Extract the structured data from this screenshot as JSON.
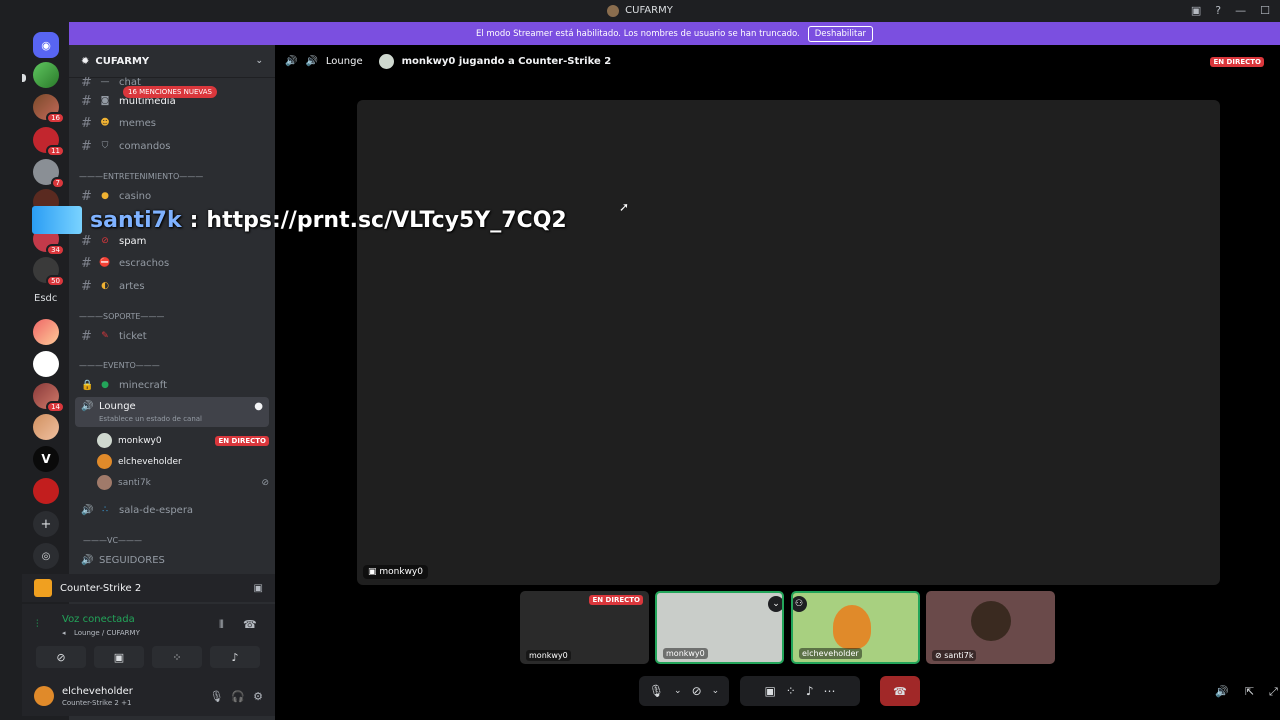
{
  "window": {
    "title": "CUFARMY"
  },
  "banner": {
    "text": "El modo Streamer está habilitado. Los nombres de usuario se han truncado.",
    "button": "Deshabilitar"
  },
  "guilds": {
    "badges": [
      "16",
      "11",
      "7",
      "34",
      "50",
      "14"
    ],
    "text_server": "Esdc"
  },
  "server": {
    "name": "CUFARMY"
  },
  "channels": {
    "chat": "chat",
    "multimedia": "multimedia",
    "mentions_pill": "16 MENCIONES NUEVAS",
    "memes": "memes",
    "comandos": "comandos",
    "cat_entretenimiento": "———ENTRETENIMIENTO———",
    "casino": "casino",
    "spam": "spam",
    "escrachos": "escrachos",
    "artes": "artes",
    "cat_soporte": "———SOPORTE———",
    "ticket": "ticket",
    "cat_evento": "———EVENTO———",
    "minecraft": "minecraft",
    "lounge": "Lounge",
    "lounge_status": "Establece un estado de canal",
    "sala_espera": "sala-de-espera",
    "cat_vc": "———VC———",
    "seguidores": "SEGUIDORES"
  },
  "voice_users": [
    {
      "name": "monkwy0",
      "live": "EN DIRECTO"
    },
    {
      "name": "elcheveholder"
    },
    {
      "name": "santi7k"
    }
  ],
  "activity": {
    "game": "Counter-Strike 2"
  },
  "voice_panel": {
    "status": "Voz conectada",
    "location": "Lounge / CUFARMY"
  },
  "user_panel": {
    "name": "elcheveholder",
    "status": "Counter-Strike 2 +1"
  },
  "main_header": {
    "channel": "Lounge",
    "activity": "monkwy0 jugando a Counter-Strike 2",
    "live": "EN DIRECTO"
  },
  "stream": {
    "owner": "monkwy0"
  },
  "tiles": [
    {
      "name": "monkwy0",
      "live": "EN DIRECTO"
    },
    {
      "name": "monkwy0"
    },
    {
      "name": "elcheveholder"
    },
    {
      "name": "santi7k"
    }
  ],
  "overlay": {
    "user": "santi7k",
    "separator": ":",
    "message": "https://prnt.sc/VLTcy5Y_7CQ2"
  },
  "colors": {
    "brand": "#7b4fe0",
    "live": "#da373c",
    "bg": "#000000",
    "sidebar": "#2b2d31"
  }
}
